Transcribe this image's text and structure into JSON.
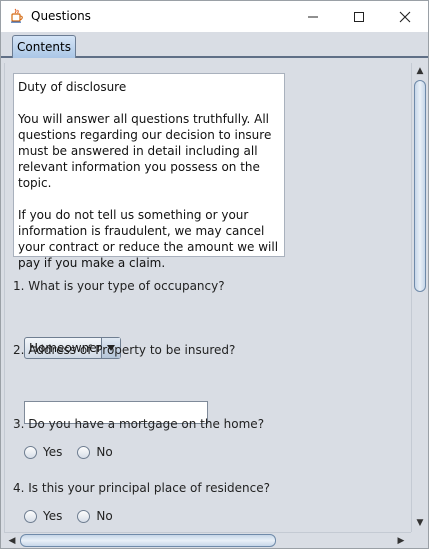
{
  "window": {
    "title": "Questions",
    "icon": "java-icon",
    "controls": [
      "minimize-icon",
      "maximize-icon",
      "close-icon"
    ]
  },
  "tabs": [
    {
      "label": "Contents",
      "selected": true
    }
  ],
  "disclosure": {
    "text": "Duty of disclosure\n\nYou will answer all questions truthfully. All questions regarding our decision to insure must be answered in detail including all relevant information you possess on the topic.\n\nIf you do not tell us something or your information is fraudulent, we may cancel your contract or reduce the amount we will pay if you make a claim."
  },
  "questions": [
    {
      "label": "1. What is your type of occupancy?",
      "type": "select",
      "selected": "Homeowner"
    },
    {
      "label": "2. Address of Property to be insured?",
      "type": "text",
      "value": ""
    },
    {
      "label": "3. Do you have a mortgage on the home?",
      "type": "radio",
      "options": [
        "Yes",
        "No"
      ]
    },
    {
      "label": "4. Is this your principal place of residence?",
      "type": "radio",
      "options": [
        "Yes",
        "No"
      ]
    }
  ]
}
